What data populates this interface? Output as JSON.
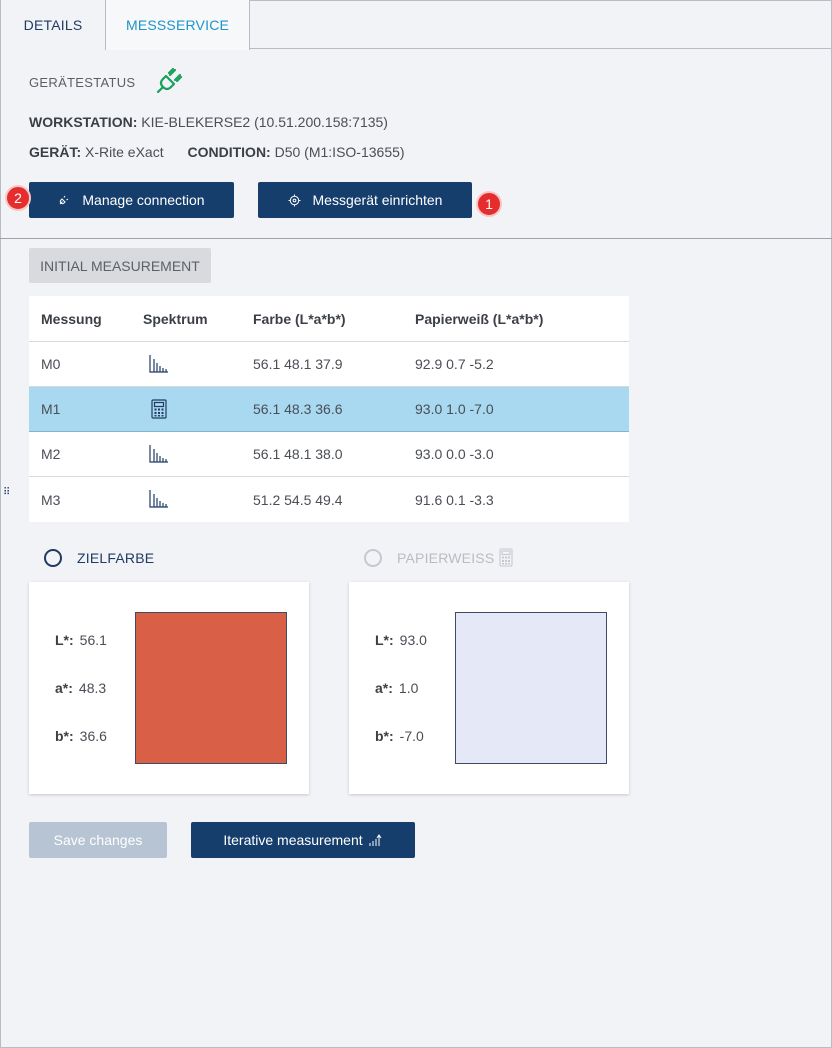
{
  "tabs": [
    {
      "label": "DETAILS"
    },
    {
      "label": "MESSSERVICE"
    }
  ],
  "device_status": {
    "label": "GERÄTESTATUS",
    "icon": "plug-connected-icon",
    "color": "#1aa05a"
  },
  "workstation": {
    "label": "WORKSTATION:",
    "value": "KIE-BLEKERSE2 (10.51.200.158:7135)"
  },
  "device": {
    "label": "GERÄT:",
    "value": "X-Rite eXact"
  },
  "condition": {
    "label": "CONDITION:",
    "value": "D50 (M1:ISO-13655)"
  },
  "buttons": {
    "manage_connection": "Manage connection",
    "setup_device": "Messgerät einrichten",
    "save_changes": "Save changes",
    "iterative_measurement": "Iterative measurement"
  },
  "badges": {
    "setup": "1",
    "manage": "2"
  },
  "section_chip": "INITIAL MEASUREMENT",
  "table": {
    "headers": [
      "Messung",
      "Spektrum",
      "Farbe (L*a*b*)",
      "Papierweiß (L*a*b*)"
    ],
    "rows": [
      {
        "messung": "M0",
        "spektrum_icon": "spectrum-chart-icon",
        "farbe": "56.1 48.1 37.9",
        "papierweiss": "92.9 0.7 -5.2",
        "selected": false
      },
      {
        "messung": "M1",
        "spektrum_icon": "calculator-icon",
        "farbe": "56.1 48.3 36.6",
        "papierweiss": "93.0 1.0 -7.0",
        "selected": true
      },
      {
        "messung": "M2",
        "spektrum_icon": "spectrum-chart-icon",
        "farbe": "56.1 48.1 38.0",
        "papierweiss": "93.0 0.0 -3.0",
        "selected": false
      },
      {
        "messung": "M3",
        "spektrum_icon": "spectrum-chart-icon",
        "farbe": "51.2 54.5 49.4",
        "papierweiss": "91.6 0.1 -3.3",
        "selected": false
      }
    ]
  },
  "target": {
    "radio_label": "ZIELFARBE",
    "l_label": "L*:",
    "l": "56.1",
    "a_label": "a*:",
    "a": "48.3",
    "b_label": "b*:",
    "b": "36.6",
    "swatch_color": "#d95f47"
  },
  "paper": {
    "radio_label": "PAPIERWEISS",
    "l_label": "L*:",
    "l": "93.0",
    "a_label": "a*:",
    "a": "1.0",
    "b_label": "b*:",
    "b": "-7.0",
    "swatch_color": "#e5e9f7"
  },
  "colors": {
    "primary": "#163e6d",
    "accent_tab": "#1d93c8",
    "selected_row": "#a9d8f1",
    "badge": "#e52d2d"
  }
}
